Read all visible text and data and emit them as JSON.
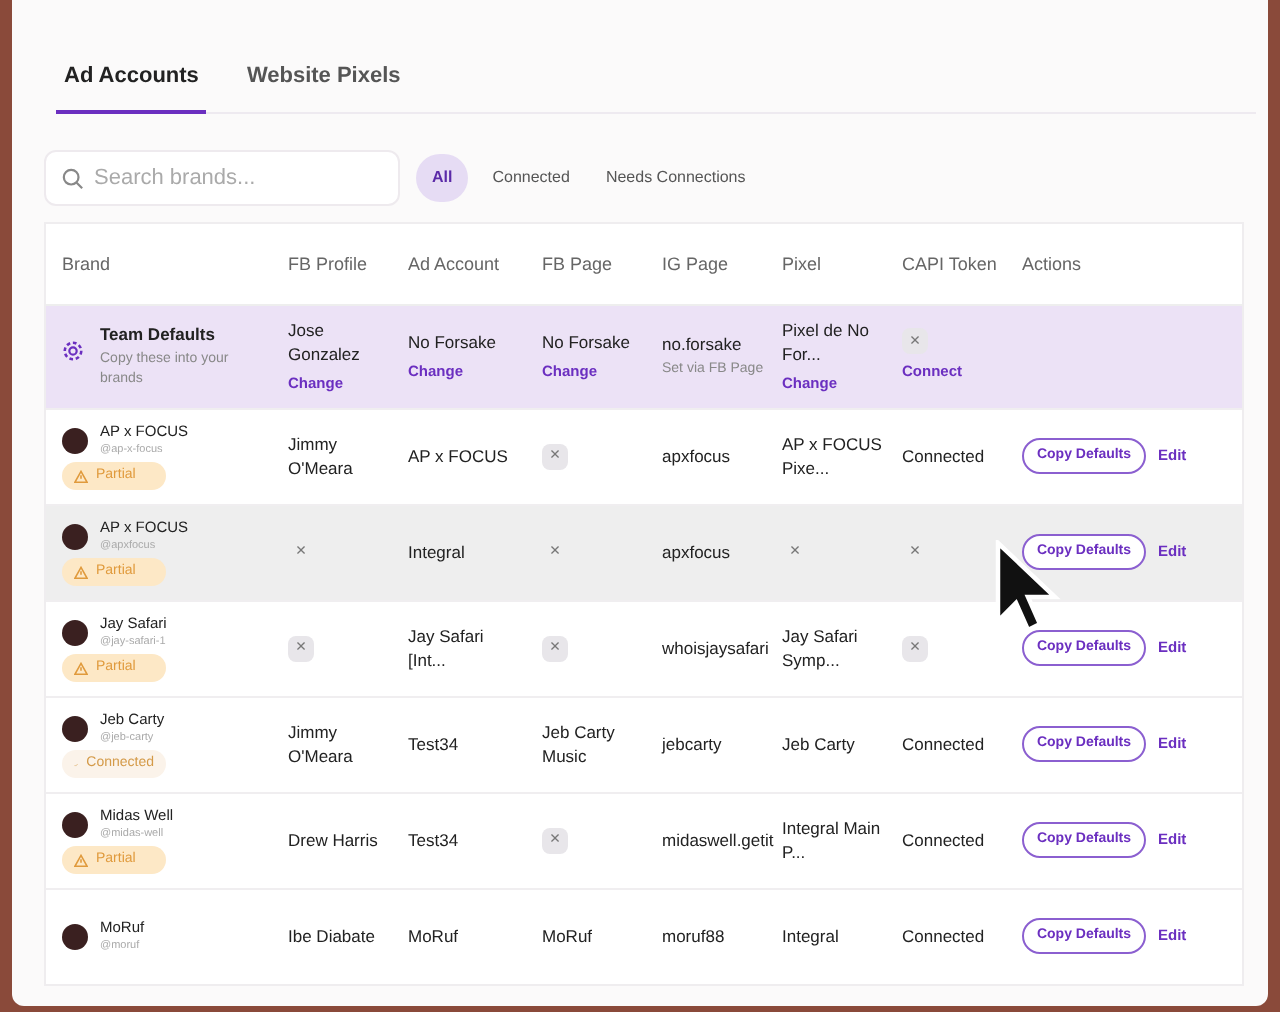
{
  "tabs": [
    {
      "label": "Ad Accounts",
      "selected": true
    },
    {
      "label": "Website Pixels",
      "selected": false
    }
  ],
  "search": {
    "placeholder": "Search brands..."
  },
  "filters": [
    {
      "label": "All",
      "selected": true
    },
    {
      "label": "Connected",
      "selected": false
    },
    {
      "label": "Needs Connections",
      "selected": false
    }
  ],
  "table": {
    "brand_column": "Brand",
    "columns": [
      "FB Profile",
      "Ad Account",
      "FB Page",
      "IG Page",
      "Pixel",
      "CAPI Token"
    ],
    "actions_column": "Actions",
    "defaults_row": {
      "title": "Team Defaults",
      "subtitle": "Copy these into your brands",
      "cells": [
        {
          "kind": "text",
          "text": "Jose Gonzalez",
          "link": "Change"
        },
        {
          "kind": "text",
          "text": "No Forsake",
          "link": "Change"
        },
        {
          "kind": "text",
          "text": "No Forsake",
          "link": "Change"
        },
        {
          "kind": "text",
          "text": "no.forsake",
          "note": "Set via FB Page"
        },
        {
          "kind": "text",
          "text": "Pixel de No For...",
          "link": "Change"
        },
        {
          "kind": "missing",
          "text": "×",
          "link": "Connect"
        }
      ]
    },
    "rows": [
      {
        "name": "AP x FOCUS",
        "handle": "@ap-x-focus",
        "status": {
          "kind": "partial",
          "label": "Partial"
        },
        "hovered": false,
        "cells": [
          {
            "kind": "text",
            "text": "Jimmy O'Meara"
          },
          {
            "kind": "text",
            "text": "AP x FOCUS"
          },
          {
            "kind": "missing",
            "text": "×"
          },
          {
            "kind": "text",
            "text": "apxfocus"
          },
          {
            "kind": "text",
            "text": "AP x FOCUS Pixe..."
          },
          {
            "kind": "text",
            "text": "Connected"
          }
        ],
        "actions": {
          "button": "Copy Defaults",
          "link": "Edit"
        }
      },
      {
        "name": "AP x FOCUS",
        "handle": "@apxfocus",
        "status": {
          "kind": "partial",
          "label": "Partial"
        },
        "hovered": true,
        "cells": [
          {
            "kind": "missing",
            "text": "×"
          },
          {
            "kind": "text",
            "text": "Integral"
          },
          {
            "kind": "missing",
            "text": "×"
          },
          {
            "kind": "text",
            "text": "apxfocus"
          },
          {
            "kind": "missing",
            "text": "×"
          },
          {
            "kind": "missing",
            "text": "×"
          }
        ],
        "actions": {
          "button": "Copy Defaults",
          "link": "Edit"
        }
      },
      {
        "name": "Jay Safari",
        "handle": "@jay-safari-1",
        "status": {
          "kind": "partial",
          "label": "Partial"
        },
        "hovered": false,
        "cells": [
          {
            "kind": "missing",
            "text": "×"
          },
          {
            "kind": "text",
            "text": "Jay Safari [Int..."
          },
          {
            "kind": "missing",
            "text": "×"
          },
          {
            "kind": "text",
            "text": "whoisjaysafari"
          },
          {
            "kind": "text",
            "text": "Jay Safari Symp..."
          },
          {
            "kind": "missing",
            "text": "×"
          }
        ],
        "actions": {
          "button": "Copy Defaults",
          "link": "Edit"
        }
      },
      {
        "name": "Jeb Carty",
        "handle": "@jeb-carty",
        "status": {
          "kind": "connected",
          "label": "Connected"
        },
        "hovered": false,
        "cells": [
          {
            "kind": "text",
            "text": "Jimmy O'Meara"
          },
          {
            "kind": "text",
            "text": "Test34"
          },
          {
            "kind": "text",
            "text": "Jeb Carty Music"
          },
          {
            "kind": "text",
            "text": "jebcarty"
          },
          {
            "kind": "text",
            "text": "Jeb Carty"
          },
          {
            "kind": "text",
            "text": "Connected"
          }
        ],
        "actions": {
          "button": "Copy Defaults",
          "link": "Edit"
        }
      },
      {
        "name": "Midas Well",
        "handle": "@midas-well",
        "status": {
          "kind": "partial",
          "label": "Partial"
        },
        "hovered": false,
        "cells": [
          {
            "kind": "text",
            "text": "Drew Harris"
          },
          {
            "kind": "text",
            "text": "Test34"
          },
          {
            "kind": "missing",
            "text": "×"
          },
          {
            "kind": "text",
            "text": "midaswell.getit"
          },
          {
            "kind": "text",
            "text": "Integral Main P..."
          },
          {
            "kind": "text",
            "text": "Connected"
          }
        ],
        "actions": {
          "button": "Copy Defaults",
          "link": "Edit"
        }
      },
      {
        "name": "MoRuf",
        "handle": "@moruf",
        "hovered": false,
        "cells": [
          {
            "kind": "text",
            "text": "Ibe Diabate"
          },
          {
            "kind": "text",
            "text": "MoRuf"
          },
          {
            "kind": "text",
            "text": "MoRuf"
          },
          {
            "kind": "text",
            "text": "moruf88"
          },
          {
            "kind": "text",
            "text": "Integral"
          },
          {
            "kind": "text",
            "text": "Connected"
          }
        ],
        "actions": {
          "button": "Copy Defaults",
          "link": "Edit"
        }
      }
    ]
  }
}
